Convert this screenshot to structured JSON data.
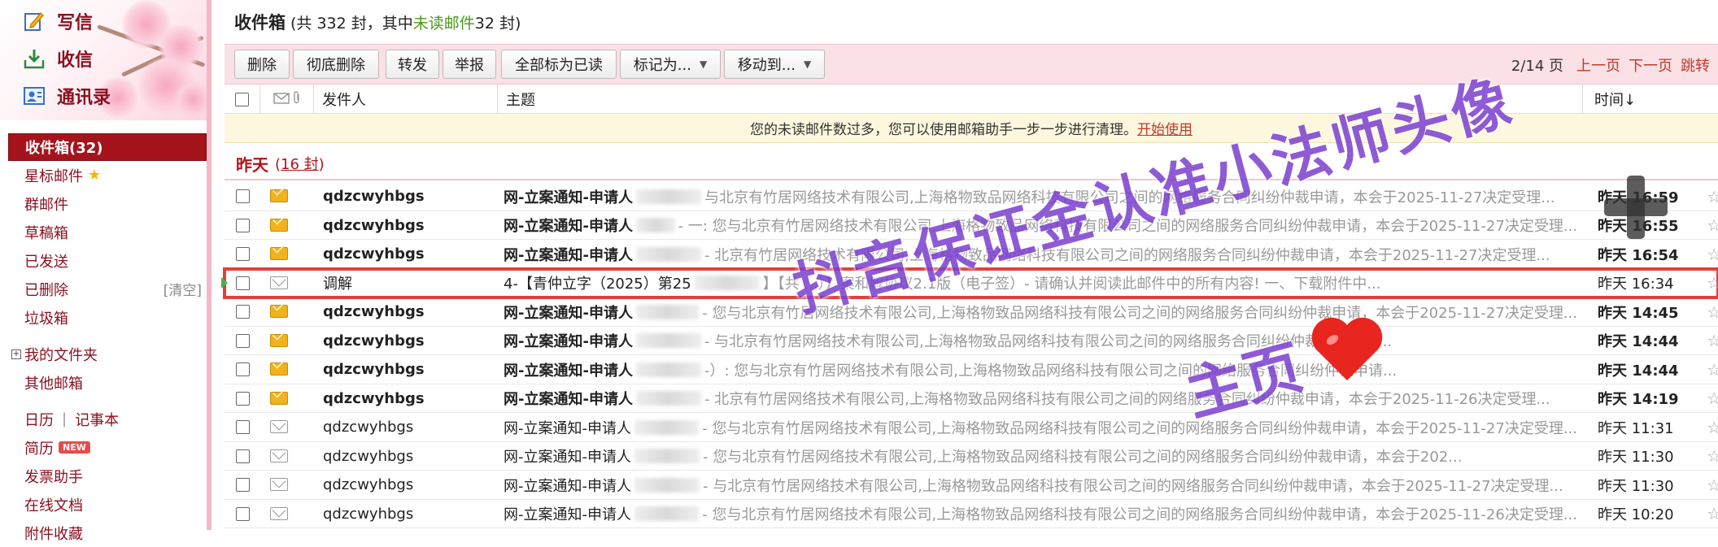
{
  "nav": {
    "compose": "写信",
    "inbox": "收信",
    "contacts": "通讯录"
  },
  "folders": {
    "inbox": "收件箱(32)",
    "starred": "星标邮件",
    "group": "群邮件",
    "drafts": "草稿箱",
    "sent": "已发送",
    "deleted": "已删除",
    "deleted_clear": "[清空]",
    "spam": "垃圾箱",
    "my_folders": "我的文件夹",
    "other_mailbox": "其他邮箱",
    "calendar": "日历",
    "calendar_sep": "|",
    "notes": "记事本",
    "resume": "简历",
    "resume_badge": "NEW",
    "invoice": "发票助手",
    "online_docs": "在线文档",
    "attachments": "附件收藏"
  },
  "header": {
    "title": "收件箱",
    "summary_prefix": "(共 332 封，其中 ",
    "unread_link": "未读邮件",
    "summary_suffix": " 32 封)"
  },
  "toolbar": {
    "delete": "删除",
    "perm_delete": "彻底删除",
    "forward": "转发",
    "report": "举报",
    "mark_all_read": "全部标为已读",
    "mark_as": "标记为...",
    "move_to": "移动到...",
    "page": "2/14 页",
    "prev": "上一页",
    "next": "下一页",
    "jump": "跳转"
  },
  "columns": {
    "from": "发件人",
    "subject": "主题",
    "time": "时间↓"
  },
  "notice": {
    "text": "您的未读邮件数过多，您可以使用邮箱助手一步一步进行清理。",
    "link": "开始使用"
  },
  "group": {
    "label": "昨天",
    "count_open": "(",
    "count": "16 封",
    "count_close": ")"
  },
  "rows": [
    {
      "from": "qdzcwyhbgs",
      "subject": "网-立案通知-申请人",
      "preview": "与北京有竹居网络技术有限公司,上海格物致品网络科技有限公司之间的网络服务合同纠纷仲裁申请，本会于2025-11-27决定受理...",
      "time": "昨天 16:59"
    },
    {
      "from": "qdzcwyhbgs",
      "subject": "网-立案通知-申请人",
      "preview": "- 一: 您与北京有竹居网络技术有限公司,上海格物致品网络科技有限公司之间的网络服务合同纠纷仲裁申请，本会于2025-11-27决定受理...",
      "time": "昨天 16:55"
    },
    {
      "from": "qdzcwyhbgs",
      "subject": "网-立案通知-申请人",
      "preview": "- 北京有竹居网络技术有限公司,上海格物致品网络科技有限公司之间的网络服务合同纠纷仲裁申请，本会于2025-11-27决定受理...",
      "time": "昨天 16:54"
    },
    {
      "from": "调解",
      "subject": "4-【青仲立字（2025）第25",
      "preview": "】【共 ...）】案和解协议2.1版（电子签）- 请确认并阅读此邮件中的所有内容! 一、下载附件中...",
      "time": "昨天 16:34"
    },
    {
      "from": "qdzcwyhbgs",
      "subject": "网-立案通知-申请人",
      "preview": "- 您与北京有竹居网络技术有限公司,上海格物致品网络科技有限公司之间的网络服务合同纠纷仲裁申请，本会于2025-11-27决定受理...",
      "time": "昨天 14:45"
    },
    {
      "from": "qdzcwyhbgs",
      "subject": "网-立案通知-申请人",
      "preview": "- 与北京有竹居网络技术有限公司,上海格物致品网络科技有限公司之间的网络服务合同纠纷仲裁申请，本...",
      "time": "昨天 14:44"
    },
    {
      "from": "qdzcwyhbgs",
      "subject": "网-立案通知-申请人",
      "preview": "-）: 您与北京有竹居网络技术有限公司,上海格物致品网络科技有限公司之间的网络服务合同纠纷仲裁申请...",
      "time": "昨天 14:44"
    },
    {
      "from": "qdzcwyhbgs",
      "subject": "网-立案通知-申请人",
      "preview": "- 北京有竹居网络技术有限公司,上海格物致品网络科技有限公司之间的网络服务合同纠纷仲裁申请，本会于2025-11-26决定受理...",
      "time": "昨天 14:19"
    },
    {
      "from": "qdzcwyhbgs",
      "subject": "网-立案通知-申请人",
      "preview": "- 您与北京有竹居网络技术有限公司,上海格物致品网络科技有限公司之间的网络服务合同纠纷仲裁申请，本会于2025-11-27决定受理...",
      "time": "昨天 11:31"
    },
    {
      "from": "qdzcwyhbgs",
      "subject": "网-立案通知-申请人",
      "preview": "- 您与北京有竹居网络技术有限公司,上海格物致品网络科技有限公司之间的网络服务合同纠纷仲裁申请，本会于202...",
      "time": "昨天 11:30"
    },
    {
      "from": "qdzcwyhbgs",
      "subject": "网-立案通知-申请人",
      "preview": "- 与北京有竹居网络技术有限公司,上海格物致品网络科技有限公司之间的网络服务合同纠纷仲裁申请，本会于2025-11-27决定受理...",
      "time": "昨天 11:30"
    },
    {
      "from": "qdzcwyhbgs",
      "subject": "网-立案通知-申请人",
      "preview": "- 您与北京有竹居网络技术有限公司,上海格物致品网络科技有限公司之间的网络服务合同纠纷仲裁申请，本会于2025-11-26决定受理...",
      "time": "昨天 10:20"
    }
  ],
  "watermark": {
    "line1": "抖音保证金认准小法师头像",
    "line2": "主页"
  },
  "colors": {
    "brand_red": "#a5141c",
    "pink": "#fbe1e5",
    "unread_green": "#4a9a1a",
    "watermark_purple": "#7b3fd0"
  }
}
